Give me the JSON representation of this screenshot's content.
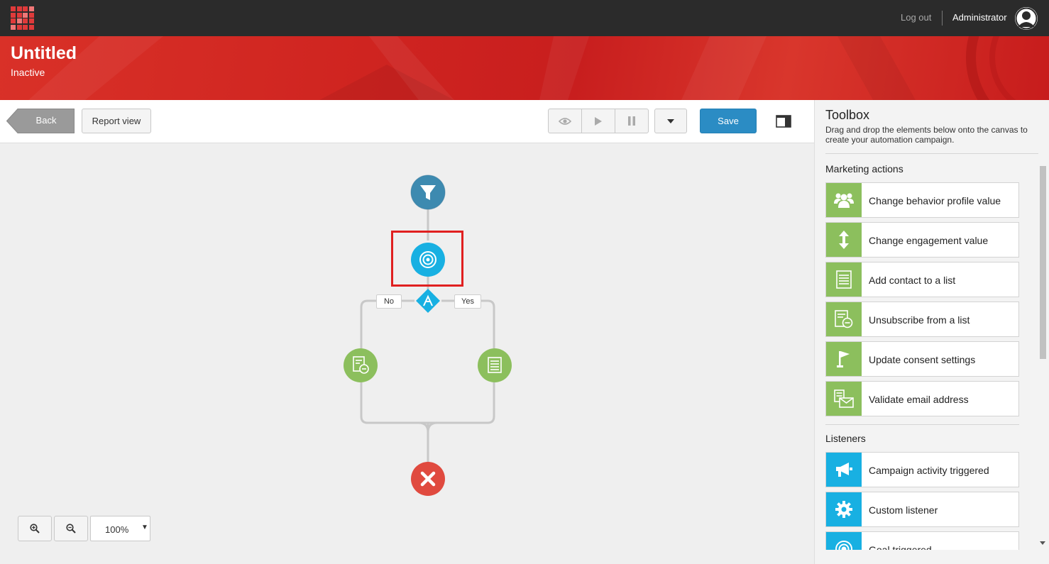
{
  "topbar": {
    "logout_label": "Log out",
    "user_name": "Administrator"
  },
  "header": {
    "title": "Untitled",
    "status": "Inactive"
  },
  "toolbar": {
    "back_label": "Back",
    "report_view_label": "Report view",
    "save_label": "Save"
  },
  "flow": {
    "branch_no_label": "No",
    "branch_yes_label": "Yes"
  },
  "zoom": {
    "value": "100%"
  },
  "toolbox": {
    "title": "Toolbox",
    "description": "Drag and drop the elements below onto the canvas to create your automation campaign.",
    "marketing_actions_label": "Marketing actions",
    "marketing_actions": [
      {
        "label": "Change behavior profile value",
        "icon": "users-icon"
      },
      {
        "label": "Change engagement value",
        "icon": "up-down-arrow-icon"
      },
      {
        "label": "Add contact to a list",
        "icon": "list-icon"
      },
      {
        "label": "Unsubscribe from a list",
        "icon": "list-remove-icon"
      },
      {
        "label": "Update consent settings",
        "icon": "flag-icon"
      },
      {
        "label": "Validate email address",
        "icon": "email-validate-icon"
      }
    ],
    "listeners_label": "Listeners",
    "listeners": [
      {
        "label": "Campaign activity triggered",
        "icon": "megaphone-icon"
      },
      {
        "label": "Custom listener",
        "icon": "gear-icon"
      },
      {
        "label": "Goal triggered",
        "icon": "target-icon"
      }
    ]
  },
  "colors": {
    "topbar": "#2b2b2b",
    "header_red": "#cf2420",
    "save_blue": "#2b8cc4",
    "action_green": "#8cbf5d",
    "listener_blue": "#18b0e2",
    "trigger_node": "#3d8ab0",
    "end_node": "#e04a3f",
    "highlight": "#e02020"
  }
}
